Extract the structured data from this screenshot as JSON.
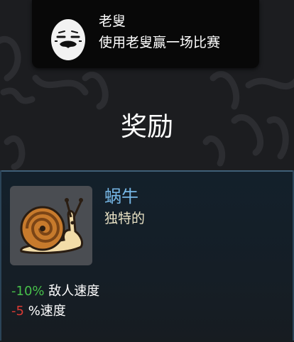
{
  "achievement": {
    "name": "老叟",
    "description": "使用老叟赢一场比赛",
    "icon": "old-man-egg-icon"
  },
  "reward": {
    "title": "奖励"
  },
  "item": {
    "name": "蜗牛",
    "rarity": "独特的",
    "icon": "snail-icon",
    "stats": [
      {
        "value": "-10%",
        "label": "敌人速度",
        "color": "#47c04a"
      },
      {
        "value": "-5",
        "label": "%速度",
        "color": "#d93a34"
      }
    ]
  },
  "colors": {
    "item_name": "#76b7e6",
    "rarity": "#e8e1c4",
    "card_border": "#3f5f78"
  }
}
